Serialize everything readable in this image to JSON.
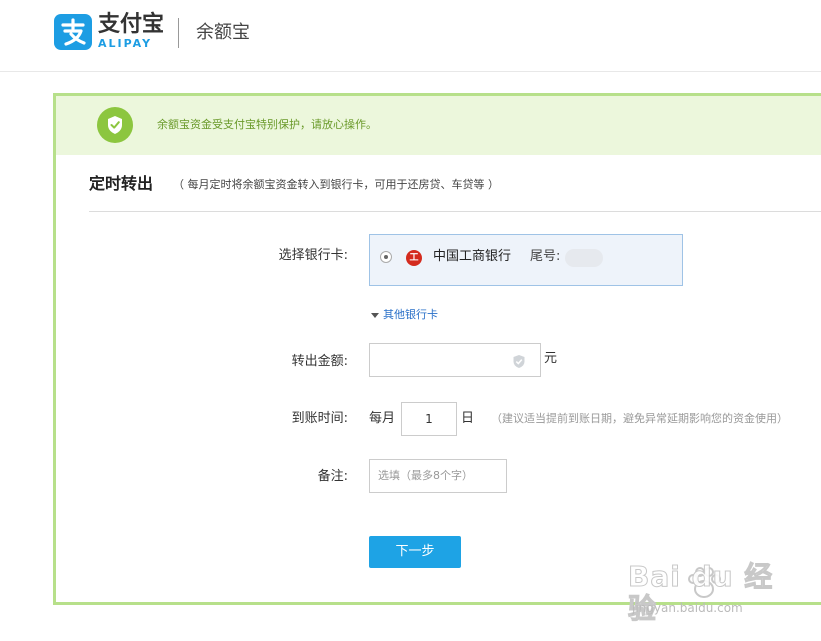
{
  "header": {
    "logo_text_cn": "支付宝",
    "logo_text_en": "ALIPAY",
    "product_name": "余额宝"
  },
  "notice": {
    "icon": "shield-check-icon",
    "text": "余额宝资金受支付宝特别保护，请放心操作。"
  },
  "page": {
    "title": "定时转出",
    "title_note": "（ 每月定时将余额宝资金转入到银行卡，可用于还房贷、车贷等 ）"
  },
  "form": {
    "bank_label": "选择银行卡:",
    "bank_name": "中国工商银行",
    "bank_icon_text": "工",
    "tail_label": "尾号:",
    "other_bank_link": "其他银行卡",
    "amount_label": "转出金额:",
    "amount_unit": "元",
    "time_label": "到账时间:",
    "each_month": "每月",
    "day_value": "1",
    "day_unit": "日",
    "day_tip": "（建议适当提前到账日期，避免异常延期影响您的资金使用）",
    "remark_label": "备注:",
    "remark_placeholder": "选填（最多8个字）",
    "next_button": "下一步"
  },
  "watermark": {
    "main": "Bai du 经验",
    "sub": "jingyan.baidu.com"
  },
  "colors": {
    "brand_blue": "#1d9de3",
    "notice_bg": "#ecf7dc",
    "frame_border": "#b7e08a",
    "button_blue": "#1ea3e5",
    "link_blue": "#2a70c8"
  }
}
